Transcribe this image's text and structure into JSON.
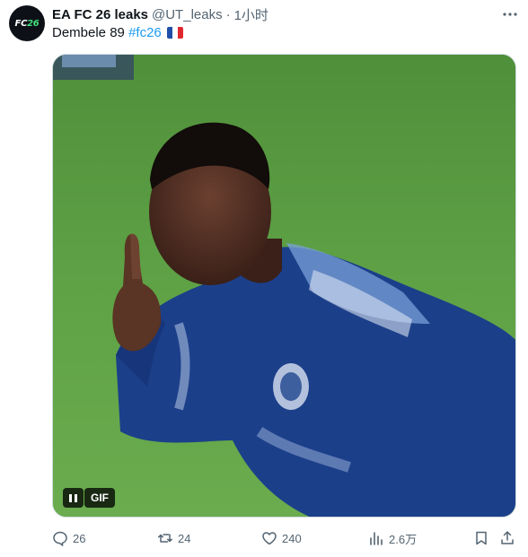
{
  "author": {
    "display_name": "EA FC 26 leaks",
    "handle": "@UT_leaks",
    "separator": "·",
    "time": "1小时",
    "avatar_text": "FC",
    "avatar_text_accent": "26"
  },
  "tweet": {
    "text": "Dembele 89",
    "hashtag": "#fc26",
    "flag": "france-flag"
  },
  "media": {
    "badge": "GIF",
    "state": "playing"
  },
  "actions": {
    "replies": "26",
    "retweets": "24",
    "likes": "240",
    "views": "2.6万"
  },
  "colors": {
    "accent": "#1d9bf0",
    "secondary_text": "#536471",
    "primary_text": "#0f1419"
  }
}
